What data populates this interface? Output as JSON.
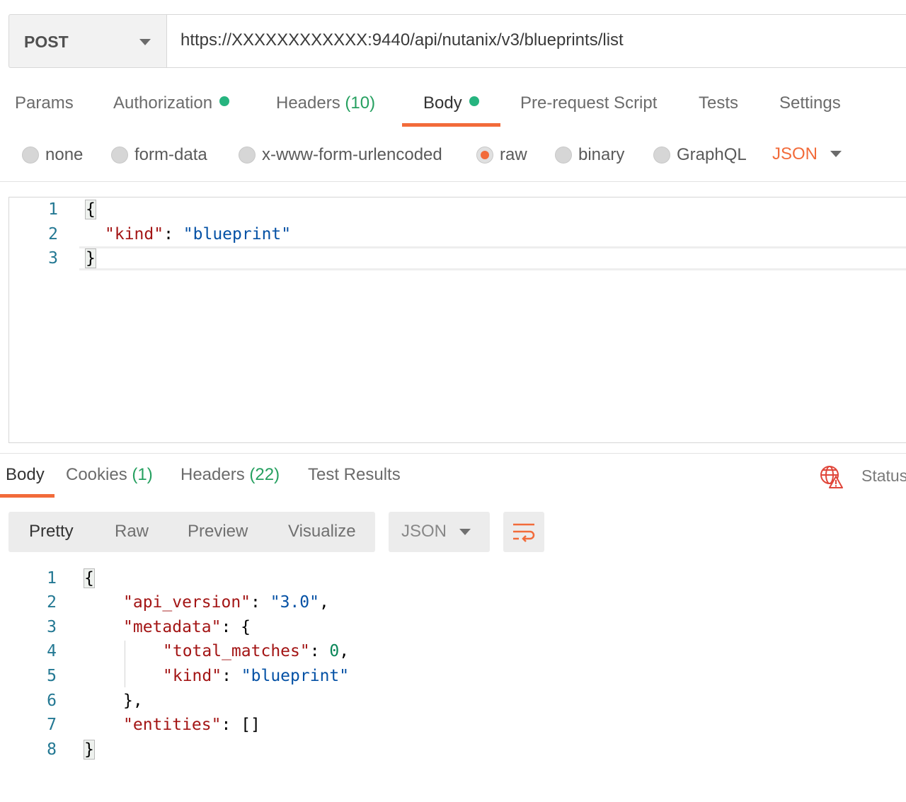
{
  "request": {
    "method": "POST",
    "url": "https://XXXXXXXXXXXX:9440/api/nutanix/v3/blueprints/list"
  },
  "request_tabs": [
    {
      "label": "Params",
      "count": "",
      "dot": false
    },
    {
      "label": "Authorization",
      "count": "",
      "dot": true
    },
    {
      "label": "Headers",
      "count": "(10)",
      "dot": false
    },
    {
      "label": "Body",
      "count": "",
      "dot": true
    },
    {
      "label": "Pre-request Script",
      "count": "",
      "dot": false
    },
    {
      "label": "Tests",
      "count": "",
      "dot": false
    },
    {
      "label": "Settings",
      "count": "",
      "dot": false
    }
  ],
  "body_types": [
    {
      "label": "none",
      "selected": false
    },
    {
      "label": "form-data",
      "selected": false
    },
    {
      "label": "x-www-form-urlencoded",
      "selected": false
    },
    {
      "label": "raw",
      "selected": true
    },
    {
      "label": "binary",
      "selected": false
    },
    {
      "label": "GraphQL",
      "selected": false
    }
  ],
  "body_language": "JSON",
  "request_body": {
    "line_numbers": [
      "1",
      "2",
      "3"
    ],
    "open_brace": "{",
    "key": "\"kind\"",
    "sep": ": ",
    "value": "\"blueprint\"",
    "close_brace": "}"
  },
  "response_tabs": [
    {
      "label": "Body",
      "count": ""
    },
    {
      "label": "Cookies",
      "count": "(1)"
    },
    {
      "label": "Headers",
      "count": "(22)"
    },
    {
      "label": "Test Results",
      "count": ""
    }
  ],
  "status_label": "Status",
  "view_modes": [
    "Pretty",
    "Raw",
    "Preview",
    "Visualize"
  ],
  "response_format": "JSON",
  "response_body": {
    "line_numbers": [
      "1",
      "2",
      "3",
      "4",
      "5",
      "6",
      "7",
      "8"
    ],
    "open_brace": "{",
    "api_version_key": "\"api_version\"",
    "api_version_val": "\"3.0\"",
    "metadata_key": "\"metadata\"",
    "total_matches_key": "\"total_matches\"",
    "total_matches_val": "0",
    "kind_key": "\"kind\"",
    "kind_val": "\"blueprint\"",
    "metadata_close": "},",
    "entities_key": "\"entities\"",
    "entities_val": "[]",
    "close_brace": "}"
  },
  "icons": {
    "method_caret": "chevron-down-icon",
    "globe": "globe-warning-icon",
    "wrap": "wrap-lines-icon"
  },
  "colors": {
    "accent": "#f26b3a",
    "success": "#26b47f"
  }
}
